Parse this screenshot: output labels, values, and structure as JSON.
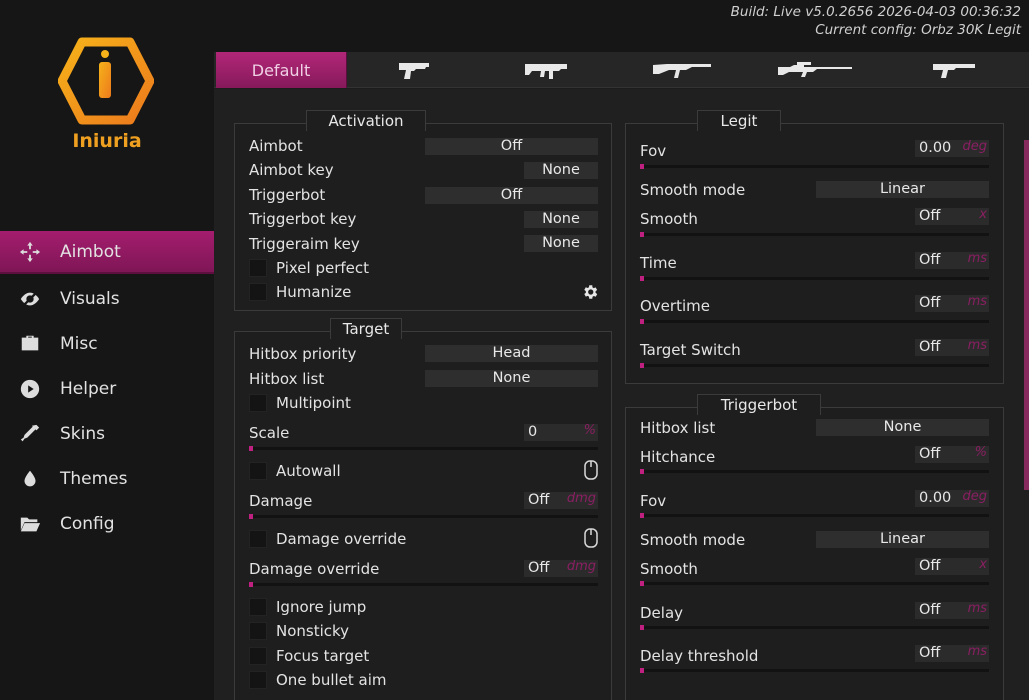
{
  "build": {
    "line1": "Build: Live v5.0.2656 2026-04-03 00:36:32",
    "line2": "Current config: Orbz 30K Legit"
  },
  "brand": {
    "name": "Iniuria",
    "colors": {
      "accent": "#a41d6e",
      "logo_orange": "#f0a020"
    }
  },
  "sidebar": {
    "items": [
      {
        "label": "Aimbot",
        "icon": "crosshair-icon",
        "active": true
      },
      {
        "label": "Visuals",
        "icon": "eye-icon"
      },
      {
        "label": "Misc",
        "icon": "briefcase-icon"
      },
      {
        "label": "Helper",
        "icon": "play-icon"
      },
      {
        "label": "Skins",
        "icon": "dropper-icon"
      },
      {
        "label": "Themes",
        "icon": "drop-icon"
      },
      {
        "label": "Config",
        "icon": "folder-icon"
      }
    ]
  },
  "tabs": {
    "default_label": "Default",
    "weapons": [
      "pistol-icon",
      "smg-icon",
      "rifle-icon",
      "sniper-icon",
      "shotgun-icon"
    ]
  },
  "activation": {
    "title": "Activation",
    "aimbot_label": "Aimbot",
    "aimbot_value": "Off",
    "aimbot_key_label": "Aimbot key",
    "aimbot_key_value": "None",
    "triggerbot_label": "Triggerbot",
    "triggerbot_value": "Off",
    "triggerbot_key_label": "Triggerbot key",
    "triggerbot_key_value": "None",
    "triggeraim_key_label": "Triggeraim key",
    "triggeraim_key_value": "None",
    "pixel_perfect": "Pixel perfect",
    "humanize": "Humanize"
  },
  "target": {
    "title": "Target",
    "hitbox_priority_label": "Hitbox priority",
    "hitbox_priority_value": "Head",
    "hitbox_list_label": "Hitbox list",
    "hitbox_list_value": "None",
    "multipoint": "Multipoint",
    "scale_label": "Scale",
    "scale_value": "0",
    "scale_unit": "%",
    "autowall": "Autowall",
    "damage_label": "Damage",
    "damage_value": "Off",
    "damage_unit": "dmg",
    "damage_override_cb": "Damage override",
    "damage_override_label": "Damage override",
    "damage_override_value": "Off",
    "damage_override_unit": "dmg",
    "ignore_jump": "Ignore jump",
    "nonsticky": "Nonsticky",
    "focus_target": "Focus target",
    "one_bullet_aim": "One bullet aim"
  },
  "legit": {
    "title": "Legit",
    "fov_label": "Fov",
    "fov_value": "0.00",
    "fov_unit": "deg",
    "smooth_mode_label": "Smooth mode",
    "smooth_mode_value": "Linear",
    "smooth_label": "Smooth",
    "smooth_value": "Off",
    "smooth_unit": "x",
    "time_label": "Time",
    "time_value": "Off",
    "time_unit": "ms",
    "overtime_label": "Overtime",
    "overtime_value": "Off",
    "overtime_unit": "ms",
    "target_switch_label": "Target Switch",
    "target_switch_value": "Off",
    "target_switch_unit": "ms"
  },
  "triggerbot": {
    "title": "Triggerbot",
    "hitbox_list_label": "Hitbox list",
    "hitbox_list_value": "None",
    "hitchance_label": "Hitchance",
    "hitchance_value": "Off",
    "hitchance_unit": "%",
    "fov_label": "Fov",
    "fov_value": "0.00",
    "fov_unit": "deg",
    "smooth_mode_label": "Smooth mode",
    "smooth_mode_value": "Linear",
    "smooth_label": "Smooth",
    "smooth_value": "Off",
    "smooth_unit": "x",
    "delay_label": "Delay",
    "delay_value": "Off",
    "delay_unit": "ms",
    "delay_threshold_label": "Delay threshold",
    "delay_threshold_value": "Off",
    "delay_threshold_unit": "ms"
  }
}
